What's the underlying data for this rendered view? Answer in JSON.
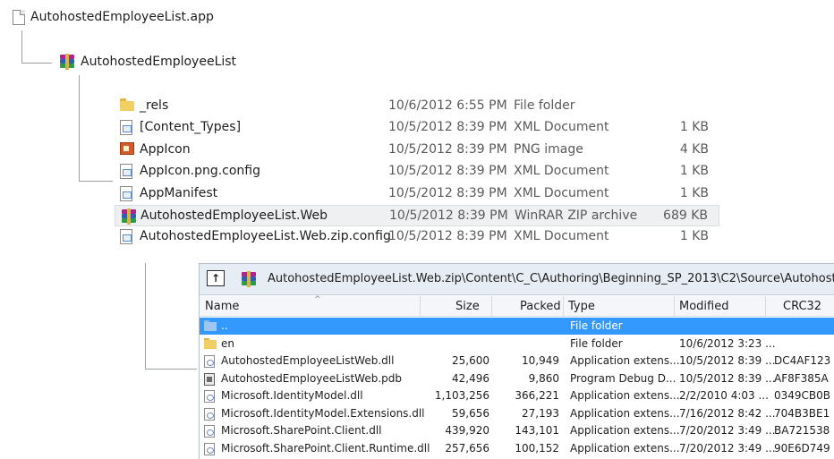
{
  "tree": {
    "root_file": "AutohostedEmployeeList.app",
    "package_node": "AutohostedEmployeeList"
  },
  "explorer": {
    "rows": [
      {
        "name": "_rels",
        "date": "10/6/2012 6:55 PM",
        "type": "File folder",
        "size": "",
        "icon": "folder-icon"
      },
      {
        "name": "[Content_Types]",
        "date": "10/5/2012 8:39 PM",
        "type": "XML Document",
        "size": "1 KB",
        "icon": "xml-document-icon"
      },
      {
        "name": "AppIcon",
        "date": "10/5/2012 8:39 PM",
        "type": "PNG image",
        "size": "4 KB",
        "icon": "png-image-icon"
      },
      {
        "name": "AppIcon.png.config",
        "date": "10/5/2012 8:39 PM",
        "type": "XML Document",
        "size": "1 KB",
        "icon": "xml-document-icon"
      },
      {
        "name": "AppManifest",
        "date": "10/5/2012 8:39 PM",
        "type": "XML Document",
        "size": "1 KB",
        "icon": "xml-document-icon"
      },
      {
        "name": "AutohostedEmployeeList.Web",
        "date": "10/5/2012 8:39 PM",
        "type": "WinRAR ZIP archive",
        "size": "689 KB",
        "icon": "winrar-archive-icon"
      },
      {
        "name": "AutohostedEmployeeList.Web.zip.config",
        "date": "10/5/2012 8:39 PM",
        "type": "XML Document",
        "size": "1 KB",
        "icon": "xml-document-icon"
      }
    ]
  },
  "winrar": {
    "path": "AutohostedEmployeeList.Web.zip\\Content\\C_C\\Authoring\\Beginning_SP_2013\\C2\\Source\\AutohostedEmployeeList\\Au",
    "up_label": "↑",
    "columns": {
      "name": "Name",
      "size": "Size",
      "packed": "Packed",
      "type": "Type",
      "modified": "Modified",
      "crc": "CRC32"
    },
    "rows": [
      {
        "name": "..",
        "size": "",
        "packed": "",
        "type": "File folder",
        "modified": "",
        "crc": "",
        "icon": "folder-icon"
      },
      {
        "name": "en",
        "size": "",
        "packed": "",
        "type": "File folder",
        "modified": "10/6/2012 3:23 ...",
        "crc": "",
        "icon": "folder-icon"
      },
      {
        "name": "AutohostedEmployeeListWeb.dll",
        "size": "25,600",
        "packed": "10,949",
        "type": "Application extens...",
        "modified": "10/5/2012 8:39 ...",
        "crc": "DC4AF123",
        "icon": "dll-icon"
      },
      {
        "name": "AutohostedEmployeeListWeb.pdb",
        "size": "42,496",
        "packed": "9,860",
        "type": "Program Debug D...",
        "modified": "10/5/2012 8:39 ...",
        "crc": "AF8F385A",
        "icon": "pdb-icon"
      },
      {
        "name": "Microsoft.IdentityModel.dll",
        "size": "1,103,256",
        "packed": "366,221",
        "type": "Application extens...",
        "modified": "2/2/2010 4:03 ...",
        "crc": "0349CB0B",
        "icon": "dll-icon"
      },
      {
        "name": "Microsoft.IdentityModel.Extensions.dll",
        "size": "59,656",
        "packed": "27,193",
        "type": "Application extens...",
        "modified": "7/16/2012 8:42 ...",
        "crc": "704B3BE1",
        "icon": "dll-icon"
      },
      {
        "name": "Microsoft.SharePoint.Client.dll",
        "size": "439,920",
        "packed": "143,101",
        "type": "Application extens...",
        "modified": "7/20/2012 3:49 ...",
        "crc": "BA721538",
        "icon": "dll-icon"
      },
      {
        "name": "Microsoft.SharePoint.Client.Runtime.dll",
        "size": "257,656",
        "packed": "100,152",
        "type": "Application extens...",
        "modified": "7/20/2012 3:49 ...",
        "crc": "90E6D749",
        "icon": "dll-icon"
      }
    ]
  },
  "colors": {
    "selection": "#3399ff",
    "connector": "#9aa0a6",
    "header_bg": "#e7edf4"
  }
}
